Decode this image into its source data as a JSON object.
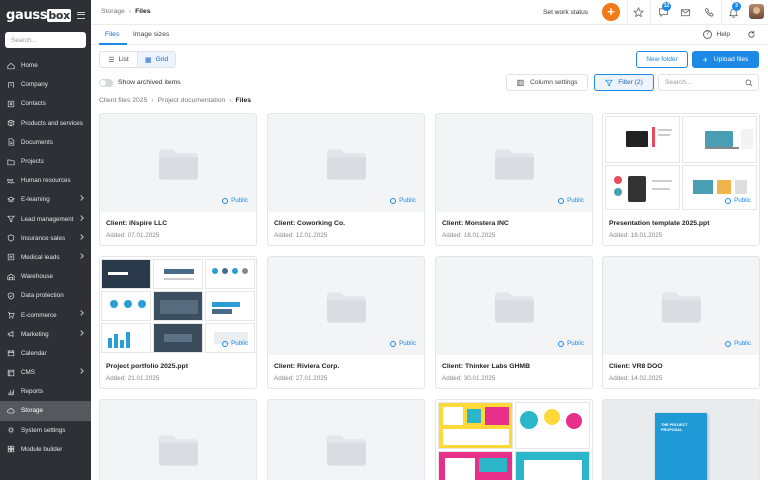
{
  "app": {
    "logo": "gaussbox",
    "search_placeholder": "Search..."
  },
  "sidebar": {
    "items": [
      {
        "label": "Home",
        "icon": "home-icon",
        "chevron": false,
        "active": false
      },
      {
        "label": "Company",
        "icon": "building-icon",
        "chevron": false,
        "active": false
      },
      {
        "label": "Contacts",
        "icon": "contacts-icon",
        "chevron": false,
        "active": false
      },
      {
        "label": "Products and services",
        "icon": "box-icon",
        "chevron": false,
        "active": false
      },
      {
        "label": "Documents",
        "icon": "document-icon",
        "chevron": false,
        "active": false
      },
      {
        "label": "Projects",
        "icon": "folder-icon",
        "chevron": false,
        "active": false
      },
      {
        "label": "Human resources",
        "icon": "people-icon",
        "chevron": false,
        "active": false
      },
      {
        "label": "E-learning",
        "icon": "learning-icon",
        "chevron": true,
        "active": false
      },
      {
        "label": "Lead management",
        "icon": "funnel-icon",
        "chevron": true,
        "active": false
      },
      {
        "label": "Insurance sales",
        "icon": "insurance-icon",
        "chevron": true,
        "active": false
      },
      {
        "label": "Medical leads",
        "icon": "medical-icon",
        "chevron": true,
        "active": false
      },
      {
        "label": "Warehouse",
        "icon": "warehouse-icon",
        "chevron": false,
        "active": false
      },
      {
        "label": "Data protection",
        "icon": "shield-icon",
        "chevron": false,
        "active": false
      },
      {
        "label": "E-commerce",
        "icon": "cart-icon",
        "chevron": true,
        "active": false
      },
      {
        "label": "Marketing",
        "icon": "megaphone-icon",
        "chevron": true,
        "active": false
      },
      {
        "label": "Calendar",
        "icon": "calendar-icon",
        "chevron": false,
        "active": false
      },
      {
        "label": "CMS",
        "icon": "cms-icon",
        "chevron": true,
        "active": false
      },
      {
        "label": "Reports",
        "icon": "chart-icon",
        "chevron": false,
        "active": false
      },
      {
        "label": "Storage",
        "icon": "cloud-icon",
        "chevron": false,
        "active": true
      },
      {
        "label": "System settings",
        "icon": "gear-icon",
        "chevron": false,
        "active": false
      },
      {
        "label": "Module builder",
        "icon": "module-icon",
        "chevron": false,
        "active": false
      }
    ]
  },
  "topbar": {
    "breadcrumb_parent": "Storage",
    "breadcrumb_current": "Files",
    "work_status": "Set work status",
    "plus_label": "+",
    "star_badge": "12",
    "bell_badge": "3",
    "accent": "#f07a16"
  },
  "tabs": {
    "files": "Files",
    "image_sizes": "Image sizes",
    "help": "Help",
    "help_icon": "?"
  },
  "toolbar": {
    "list_label": "List",
    "grid_label": "Grid",
    "new_folder": "New folder",
    "upload_files": "Upload files",
    "show_archived": "Show archived items",
    "column_settings": "Column settings",
    "filter": "Filter (2)",
    "search_placeholder": "Search...",
    "primary_color": "#1e88e5"
  },
  "breadcrumb": {
    "level1": "Client files 2025",
    "level2": "Project documentation",
    "current": "Files"
  },
  "files": [
    {
      "name": "Client: iNspire LLC",
      "added": "Added: 07.01.2025",
      "visibility": "Public",
      "kind": "folder"
    },
    {
      "name": "Client: Coworking Co.",
      "added": "Added: 12.01.2025",
      "visibility": "Public",
      "kind": "folder"
    },
    {
      "name": "Client: Monstera INC",
      "added": "Added: 18.01.2025",
      "visibility": "Public",
      "kind": "folder"
    },
    {
      "name": "Presentation template 2025.ppt",
      "added": "Added: 18.01.2025",
      "visibility": "Public",
      "kind": "slides-a"
    },
    {
      "name": "Project portfolio 2025.ppt",
      "added": "Added: 21.01.2025",
      "visibility": "Public",
      "kind": "slides-b"
    },
    {
      "name": "Client: Riviera Corp.",
      "added": "Added: 27.01.2025",
      "visibility": "Public",
      "kind": "folder"
    },
    {
      "name": "Client: Thinker Labs GHMB",
      "added": "Added: 30.01.2025",
      "visibility": "Public",
      "kind": "folder"
    },
    {
      "name": "Client: VR8 DOO",
      "added": "Added: 14.02.2025",
      "visibility": "Public",
      "kind": "folder"
    },
    {
      "name": "",
      "added": "",
      "visibility": "",
      "kind": "folder"
    },
    {
      "name": "",
      "added": "",
      "visibility": "",
      "kind": "folder"
    },
    {
      "name": "",
      "added": "",
      "visibility": "",
      "kind": "slides-c"
    },
    {
      "name": "",
      "added": "",
      "visibility": "",
      "kind": "proposal",
      "cover_title": "THE PROJECT PROPOSAL"
    }
  ]
}
